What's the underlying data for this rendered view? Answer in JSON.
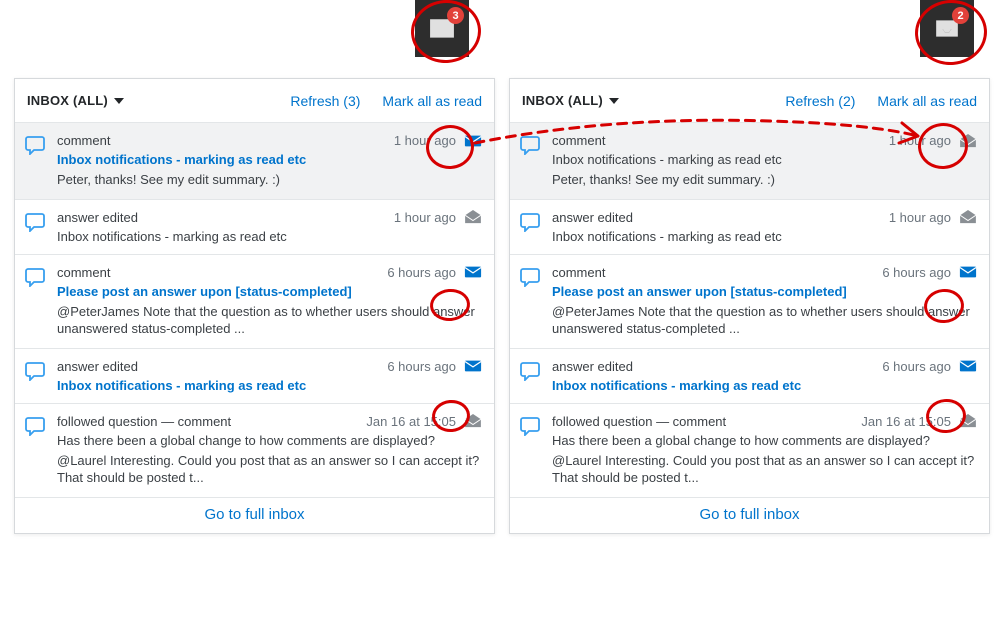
{
  "topbar": {
    "left_badge": "3",
    "right_badge": "2"
  },
  "panels": [
    {
      "header_title": "INBOX (ALL)",
      "refresh_label": "Refresh (3)",
      "mark_all_label": "Mark all as read",
      "footer_label": "Go to full inbox",
      "items": [
        {
          "type": "comment",
          "time": "1 hour ago",
          "title": "Inbox notifications - marking as read etc",
          "body": "Peter, thanks! See my edit summary. :)",
          "unread": true,
          "selected": true
        },
        {
          "type": "answer edited",
          "time": "1 hour ago",
          "title": "Inbox notifications - marking as read etc",
          "body": "",
          "unread": false,
          "selected": false
        },
        {
          "type": "comment",
          "time": "6 hours ago",
          "title": "Please post an answer upon [status-completed]",
          "body": "@PeterJames Note that the question as to whether users should answer unanswered status-completed ...",
          "unread": true,
          "selected": false
        },
        {
          "type": "answer edited",
          "time": "6 hours ago",
          "title": "Inbox notifications - marking as read etc",
          "body": "",
          "unread": true,
          "selected": false
        },
        {
          "type": "followed question — comment",
          "time": "Jan 16 at 15:05",
          "title": "Has there been a global change to how comments are displayed?",
          "body": "@Laurel Interesting. Could you post that as an answer so I can accept it? That should be posted t...",
          "unread": false,
          "selected": false
        }
      ]
    },
    {
      "header_title": "INBOX (ALL)",
      "refresh_label": "Refresh (2)",
      "mark_all_label": "Mark all as read",
      "footer_label": "Go to full inbox",
      "items": [
        {
          "type": "comment",
          "time": "1 hour ago",
          "title": "Inbox notifications - marking as read etc",
          "body": "Peter, thanks! See my edit summary. :)",
          "unread": false,
          "selected": true
        },
        {
          "type": "answer edited",
          "time": "1 hour ago",
          "title": "Inbox notifications - marking as read etc",
          "body": "",
          "unread": false,
          "selected": false
        },
        {
          "type": "comment",
          "time": "6 hours ago",
          "title": "Please post an answer upon [status-completed]",
          "body": "@PeterJames Note that the question as to whether users should answer unanswered status-completed ...",
          "unread": true,
          "selected": false
        },
        {
          "type": "answer edited",
          "time": "6 hours ago",
          "title": "Inbox notifications - marking as read etc",
          "body": "",
          "unread": true,
          "selected": false
        },
        {
          "type": "followed question — comment",
          "time": "Jan 16 at 15:05",
          "title": "Has there been a global change to how comments are displayed?",
          "body": "@Laurel Interesting. Could you post that as an answer so I can accept it? That should be posted t...",
          "unread": false,
          "selected": false
        }
      ]
    }
  ],
  "colors": {
    "link": "#0074cc",
    "unread_envelope": "#0074cc",
    "read_envelope": "#8a8f94",
    "badge": "#e2413a",
    "annotation": "#d60000"
  }
}
